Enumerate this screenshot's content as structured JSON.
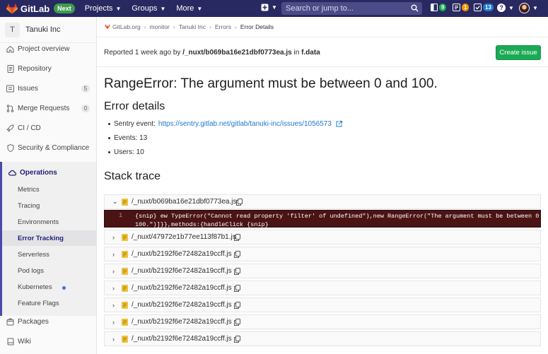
{
  "navbar": {
    "brand": "GitLab",
    "badge": "Next",
    "menu": [
      {
        "label": "Projects"
      },
      {
        "label": "Groups"
      },
      {
        "label": "More"
      }
    ],
    "search_placeholder": "Search or jump to...",
    "counters": {
      "merge_requests": "9",
      "issues": "1",
      "todos": "13"
    },
    "colors": {
      "bg": "#292961",
      "green": "#1aaa55",
      "orange": "#fc9403",
      "blue": "#1f78d1"
    }
  },
  "sidebar": {
    "project_initial": "T",
    "project_name": "Tanuki Inc",
    "items": [
      {
        "label": "Project overview",
        "icon": "home-icon"
      },
      {
        "label": "Repository",
        "icon": "doc-icon"
      },
      {
        "label": "Issues",
        "icon": "issues-icon",
        "count": "5"
      },
      {
        "label": "Merge Requests",
        "icon": "merge-icon",
        "count": "0"
      },
      {
        "label": "CI / CD",
        "icon": "rocket-icon"
      },
      {
        "label": "Security & Compliance",
        "icon": "shield-icon"
      }
    ],
    "operations": {
      "label": "Operations",
      "sub": [
        "Metrics",
        "Tracing",
        "Environments",
        "Error Tracking",
        "Serverless",
        "Pod logs",
        "Kubernetes",
        "Feature Flags"
      ],
      "active_index": 3
    },
    "bottom_items": [
      {
        "label": "Packages",
        "icon": "package-icon"
      },
      {
        "label": "Wiki",
        "icon": "book-icon"
      }
    ]
  },
  "breadcrumb": [
    "GitLab.org",
    "monitor",
    "Tanuki Inc",
    "Errors",
    "Error Details"
  ],
  "reported": {
    "prefix": "Reported 1 week ago by",
    "file": "/_nuxt/b069ba16e21dbf0773ea.js",
    "in_text": "in",
    "func": "f.data"
  },
  "create_issue_label": "Create issue",
  "error_title": "RangeError: The argument must be between 0 and 100.",
  "error_details": {
    "heading": "Error details",
    "sentry_label": "Sentry event:",
    "sentry_url": "https://sentry.gitlab.net/gitlab/tanuki-inc/issues/1056573",
    "events": "Events: 13",
    "users": "Users: 10"
  },
  "stack_trace": {
    "heading": "Stack trace",
    "frames": [
      "/_nuxt/b069ba16e21dbf0773ea.js",
      "/_nuxt/47972e1b77ee113f87b1.js",
      "/_nuxt/b2192f6e72482a19ccff.js",
      "/_nuxt/b2192f6e72482a19ccff.js",
      "/_nuxt/b2192f6e72482a19ccff.js",
      "/_nuxt/b2192f6e72482a19ccff.js",
      "/_nuxt/b2192f6e72482a19ccff.js",
      "/_nuxt/b2192f6e72482a19ccff.js"
    ],
    "code_line_number": "1",
    "code_line_1": "{snip} ew TypeError(\"Cannot read property 'filter' of undefined\"),new RangeError(\"The argument must be between 0 and",
    "code_line_2": "100.\")]}},methods:{handleClick {snip}"
  }
}
